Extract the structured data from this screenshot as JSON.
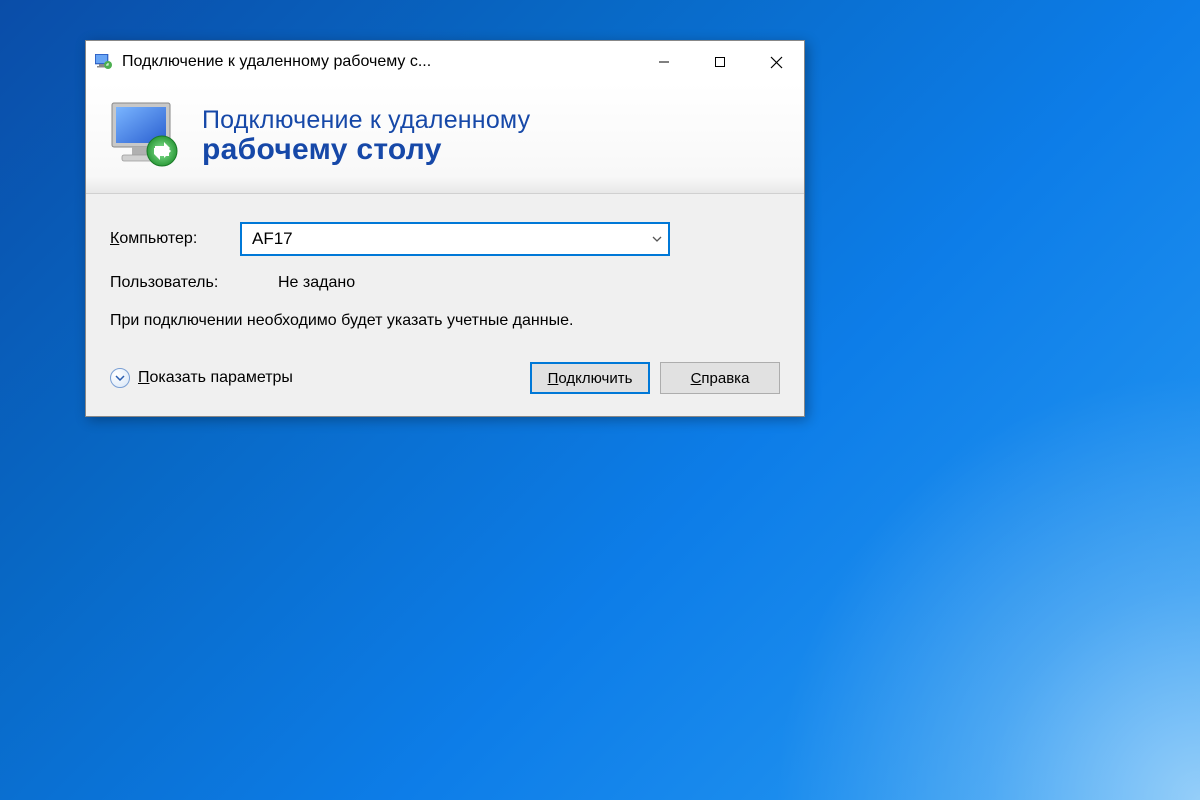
{
  "window": {
    "title": "Подключение к удаленному рабочему с..."
  },
  "banner": {
    "line1": "Подключение к удаленному",
    "line2": "рабочему столу"
  },
  "form": {
    "computer_label": "Компьютер:",
    "computer_value": "AF17",
    "user_label": "Пользователь:",
    "user_value": "Не задано",
    "info_text": "При подключении необходимо будет указать учетные данные."
  },
  "actions": {
    "show_options": "Показать параметры",
    "connect": "Подключить",
    "help": "Справка"
  }
}
